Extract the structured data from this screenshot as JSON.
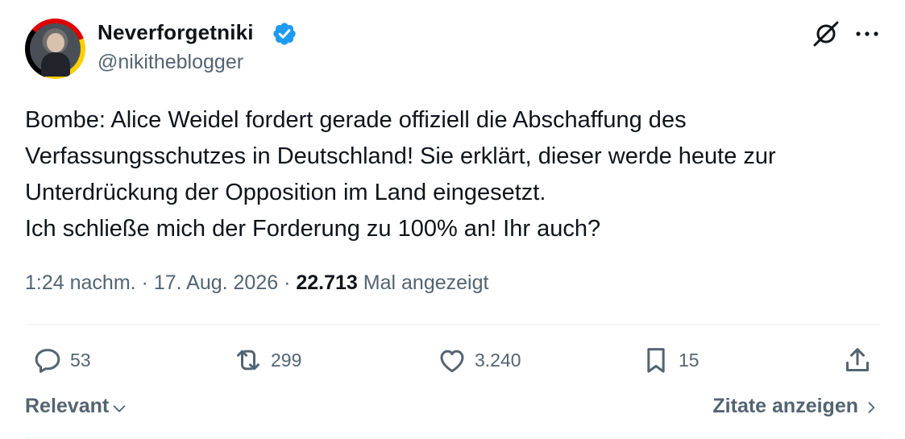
{
  "author": {
    "display_name": "Neverforgetniki",
    "handle": "@nikitheblogger"
  },
  "tweet": {
    "text": "Bombe: Alice Weidel fordert gerade offiziell die Abschaffung des\nVerfassungsschutzes in Deutschland! Sie erklärt, dieser werde heute zur\nUnterdrückung der Opposition im Land eingesetzt.\nIch schließe mich der Forderung zu 100% an! Ihr auch?"
  },
  "meta": {
    "time": "1:24 nachm.",
    "separator": "·",
    "date": "17. Aug. 2026",
    "views_count": "22.713",
    "views_label": "Mal angezeigt"
  },
  "actions": {
    "replies": "53",
    "reposts": "299",
    "likes": "3.240",
    "bookmarks": "15"
  },
  "footer": {
    "sort_label": "Relevant",
    "quotes_label": "Zitate anzeigen"
  },
  "colors": {
    "text": "#0f1419",
    "secondary": "#536471",
    "verified": "#1d9bf0",
    "divider": "#eff3f4"
  },
  "icons": [
    "verified-badge-icon",
    "grok-icon",
    "more-icon",
    "reply-icon",
    "repost-icon",
    "like-icon",
    "bookmark-icon",
    "share-icon",
    "chevron-down-icon",
    "chevron-right-icon"
  ]
}
